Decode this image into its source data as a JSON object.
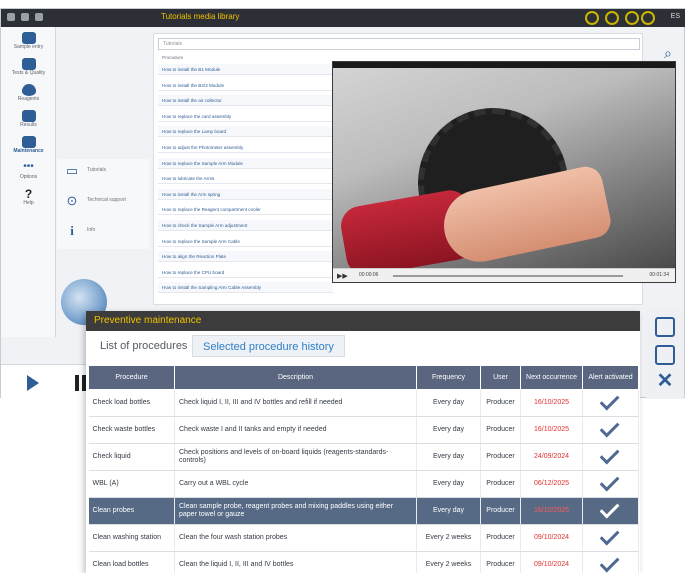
{
  "background_app": {
    "title": "Tutorials media library",
    "top_right_label": "ES",
    "nav_items": [
      {
        "label": "Sample entry"
      },
      {
        "label": "Tests & Quality"
      },
      {
        "label": "Reagents"
      },
      {
        "label": "Results"
      },
      {
        "label": "Maintenance"
      },
      {
        "label": "Options"
      },
      {
        "label": "Help"
      }
    ],
    "sub_items": [
      {
        "label": "Tutorials"
      },
      {
        "label": "Technical support"
      },
      {
        "label": "Info"
      }
    ],
    "search_placeholder": "Tutorials",
    "tutorial_header": "Procedure",
    "tutorials": [
      "How to install the B1 Module",
      "How to install the B2/3 Module",
      "How to install the air collector",
      "How to replace the card assembly",
      "How to replace the Lamp board",
      "How to adjust the Photometer assembly",
      "How to replace the Sample Arm Module",
      "How to lubricate the Arms",
      "How to install the Arm spring",
      "How to replace the Reagent compartment cooler",
      "How to check the Sample Arm adjustment",
      "How to replace the Sample Arm Cable",
      "How to align the Reaction Plate",
      "How to replace the CPU board",
      "How to install the Sampling Arm Cable Assembly"
    ],
    "video": {
      "time_label": "00:00:06",
      "duration_label": "00:01:34"
    }
  },
  "dialog": {
    "title": "Preventive maintenance",
    "tabs": [
      {
        "label": "List of procedures",
        "active": true
      },
      {
        "label": "Selected procedure history",
        "active": false
      }
    ],
    "columns": [
      "Procedure",
      "Description",
      "Frequency",
      "User",
      "Next occurrence",
      "Alert activated"
    ],
    "rows": [
      {
        "procedure": "Check load bottles",
        "description": "Check liquid I, II, III and IV bottles and refill if needed",
        "frequency": "Every day",
        "user": "Producer",
        "next": "16/10/2025",
        "alert": true,
        "selected": false
      },
      {
        "procedure": "Check waste bottles",
        "description": "Check waste I and II tanks and empty if needed",
        "frequency": "Every day",
        "user": "Producer",
        "next": "16/10/2025",
        "alert": true,
        "selected": false
      },
      {
        "procedure": "Check liquid",
        "description": "Check positions and levels of on-board liquids (reagents-standards-controls)",
        "frequency": "Every day",
        "user": "Producer",
        "next": "24/09/2024",
        "alert": true,
        "selected": false
      },
      {
        "procedure": "WBL (A)",
        "description": "Carry out a WBL cycle",
        "frequency": "Every day",
        "user": "Producer",
        "next": "06/12/2025",
        "alert": true,
        "selected": false
      },
      {
        "procedure": "Clean probes",
        "description": "Clean sample probe, reagent probes and mixing paddles using either paper towel or gauze",
        "frequency": "Every day",
        "user": "Producer",
        "next": "16/10/2025",
        "alert": true,
        "selected": true
      },
      {
        "procedure": "Clean washing station",
        "description": "Clean the four wash station probes",
        "frequency": "Every 2 weeks",
        "user": "Producer",
        "next": "09/10/2024",
        "alert": true,
        "selected": false
      },
      {
        "procedure": "Clean load bottles",
        "description": "Clean the liquid I, II, III and IV bottles",
        "frequency": "Every 2 weeks",
        "user": "Producer",
        "next": "09/10/2024",
        "alert": true,
        "selected": false
      }
    ]
  },
  "colors": {
    "accent": "#2f5d95",
    "title_yellow": "#f2c200",
    "table_header": "#5a6680",
    "selected_row": "#566a86",
    "date_red": "#e03030"
  }
}
